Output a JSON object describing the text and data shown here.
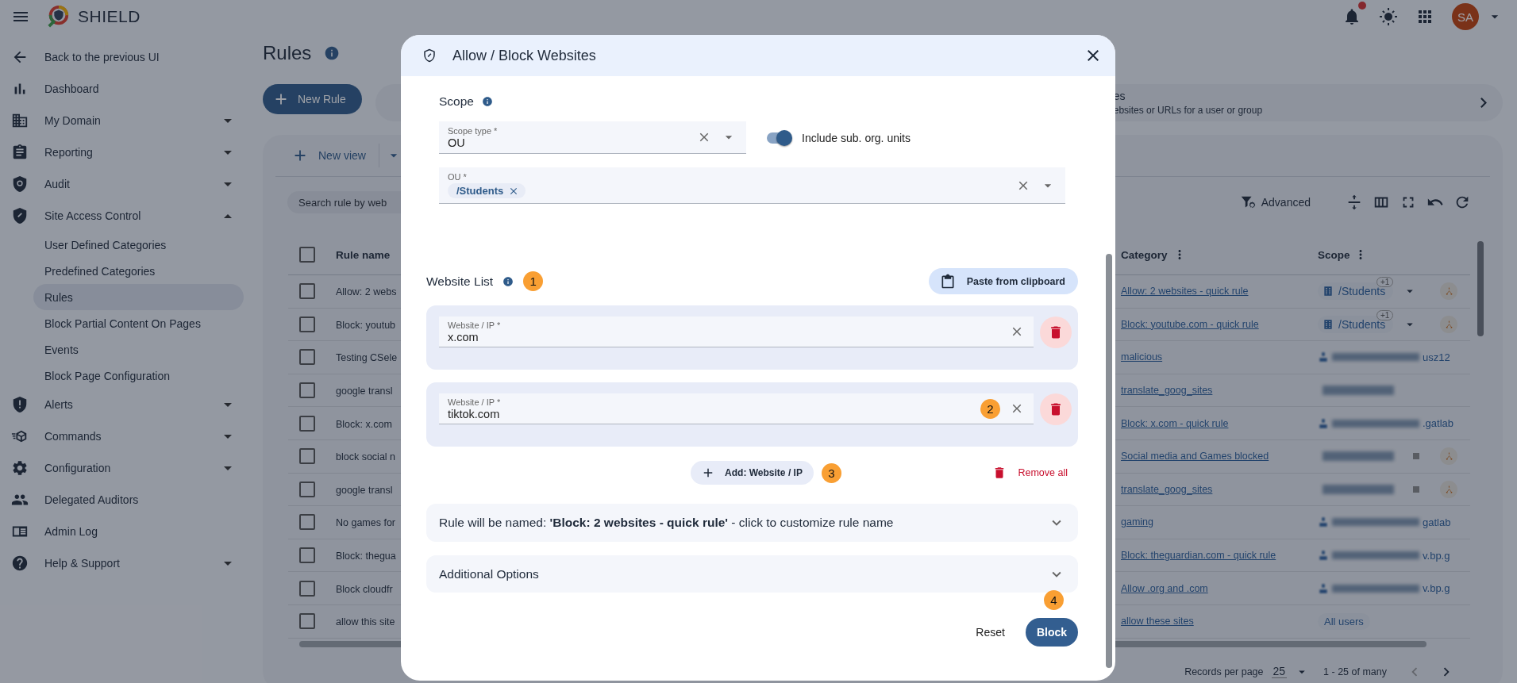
{
  "header": {
    "app_name": "SHIELD",
    "user_initials": "SA",
    "has_unread_notifications": true
  },
  "sidebar": {
    "back_link": "Back to the previous UI",
    "items": [
      {
        "label": "Dashboard"
      },
      {
        "label": "My Domain",
        "expanded": false
      },
      {
        "label": "Reporting",
        "expanded": false
      },
      {
        "label": "Audit",
        "expanded": false
      },
      {
        "label": "Site Access Control",
        "expanded": true,
        "children": [
          {
            "label": "User Defined Categories",
            "selected": false
          },
          {
            "label": "Predefined Categories",
            "selected": false
          },
          {
            "label": "Rules",
            "selected": true
          },
          {
            "label": "Block Partial Content On Pages",
            "selected": false
          },
          {
            "label": "Events",
            "selected": false
          },
          {
            "label": "Block Page Configuration",
            "selected": false
          }
        ]
      },
      {
        "label": "Alerts",
        "expanded": false
      },
      {
        "label": "Commands",
        "expanded": false
      },
      {
        "label": "Configuration",
        "expanded": false
      },
      {
        "label": "Delegated Auditors"
      },
      {
        "label": "Admin Log"
      },
      {
        "label": "Help & Support",
        "expanded": false
      }
    ]
  },
  "page": {
    "title": "Rules",
    "new_rule_button": "New Rule",
    "banner": {
      "title": "es",
      "subtitle": "ebsites or URLs for a user or group"
    }
  },
  "table": {
    "new_view_button": "New view",
    "search": {
      "placeholder": "Search rule by web"
    },
    "advanced_filter": "Advanced",
    "select_all_checked": false,
    "columns": [
      "Rule name",
      "Category",
      "Scope"
    ],
    "rows": [
      {
        "checked": false,
        "rule_name": "Allow: 2 webs",
        "category": "Allow: 2 websites - quick rule",
        "scope": {
          "kind": "ou",
          "text": "/Students",
          "extra": "+1",
          "inherited": true
        }
      },
      {
        "checked": false,
        "rule_name": "Block: youtub",
        "category": "Block: youtube.com - quick rule",
        "scope": {
          "kind": "ou",
          "text": "/Students",
          "extra": "+1",
          "inherited": true
        }
      },
      {
        "checked": false,
        "rule_name": "Testing CSele",
        "category": "malicious",
        "scope": {
          "kind": "redacted-user",
          "tail": "usz12",
          "inherited": false
        }
      },
      {
        "checked": false,
        "rule_name": "google transl",
        "category": "translate_goog_sites",
        "scope": {
          "kind": "redacted-ou",
          "inherited": false
        }
      },
      {
        "checked": false,
        "rule_name": "Block: x.com",
        "category": "Block: x.com - quick rule",
        "scope": {
          "kind": "redacted-user",
          "tail": ".gatlab",
          "inherited": false
        }
      },
      {
        "checked": false,
        "rule_name": "block social n",
        "category": "Social media and Games blocked",
        "scope": {
          "kind": "redacted-ou",
          "inherited": true
        }
      },
      {
        "checked": false,
        "rule_name": "google transl",
        "category": "translate_goog_sites",
        "scope": {
          "kind": "redacted-ou",
          "inherited": true
        }
      },
      {
        "checked": false,
        "rule_name": "No games for",
        "category": "gaming",
        "scope": {
          "kind": "redacted-user",
          "tail": "gatlab",
          "inherited": false
        }
      },
      {
        "checked": false,
        "rule_name": "Block: thegua",
        "category": "Block: theguardian.com - quick rule",
        "scope": {
          "kind": "redacted-user",
          "tail": "v.bp.g",
          "inherited": false
        }
      },
      {
        "checked": false,
        "rule_name": "Block cloudfr",
        "category": "Allow .org and .com",
        "scope": {
          "kind": "redacted-user",
          "tail": "v.bp.g",
          "inherited": false
        }
      },
      {
        "checked": false,
        "rule_name": "allow this site",
        "category": "allow these sites",
        "scope": {
          "kind": "all",
          "text": "All users",
          "inherited": false
        }
      }
    ],
    "pagination": {
      "label": "Records per page",
      "per_page": "25",
      "range": "1 - 25 of many"
    }
  },
  "dialog": {
    "title": "Allow / Block Websites",
    "scope": {
      "heading": "Scope",
      "scope_type": {
        "label": "Scope type *",
        "value": "OU"
      },
      "include_sub": {
        "label": "Include sub. org. units",
        "on": true
      },
      "ou": {
        "label": "OU *",
        "chips": [
          "/Students"
        ]
      }
    },
    "website_list": {
      "heading": "Website List",
      "marker": "1",
      "paste_button": "Paste from clipboard",
      "entries": [
        {
          "label": "Website / IP *",
          "value": "x.com"
        },
        {
          "label": "Website / IP *",
          "value": "tiktok.com",
          "marker": "2"
        }
      ],
      "add_button": "Add: Website / IP",
      "add_marker": "3",
      "remove_all": "Remove all"
    },
    "rule_name_panel": {
      "text": "Rule will be named: **'Block: 2 websites - quick rule'** - click to customize rule name",
      "expanded": false
    },
    "additional_options": {
      "text": "Additional Options",
      "expanded": false
    },
    "footer": {
      "marker": "4",
      "reset": "Reset",
      "submit": "Block"
    }
  }
}
